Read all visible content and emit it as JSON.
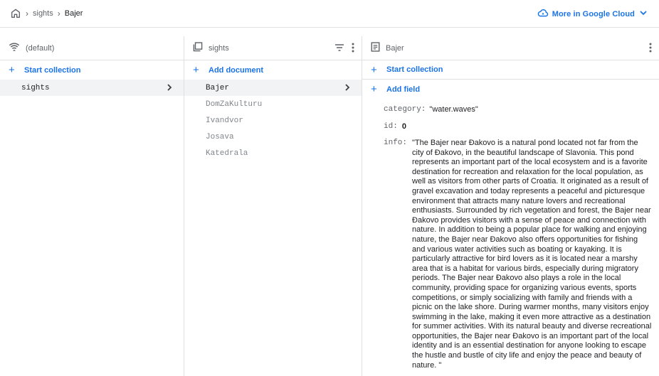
{
  "breadcrumb": {
    "items": [
      "sights",
      "Bajer"
    ]
  },
  "header": {
    "cloud_label": "More in Google Cloud"
  },
  "col1": {
    "title": "(default)",
    "action": "Start collection",
    "items": [
      {
        "label": "sights",
        "selected": true
      }
    ]
  },
  "col2": {
    "title": "sights",
    "action": "Add document",
    "items": [
      {
        "label": "Bajer",
        "selected": true
      },
      {
        "label": "DomZaKulturu"
      },
      {
        "label": "Ivandvor"
      },
      {
        "label": "Josava"
      },
      {
        "label": "Katedrala"
      }
    ]
  },
  "col3": {
    "title": "Bajer",
    "start_collection": "Start collection",
    "add_field": "Add field",
    "fields": {
      "category_key": "category:",
      "category_value": "\"water.waves\"",
      "id_key": "id:",
      "id_value": "0",
      "info_key": "info:",
      "info_value": "\"The Bajer near Đakovo is a natural pond located not far from the city of Đakovo, in the beautiful landscape of Slavonia. This pond represents an important part of the local ecosystem and is a favorite destination for recreation and relaxation for the local population, as well as visitors from other parts of Croatia. It originated as a result of gravel excavation and today represents a peaceful and picturesque environment that attracts many nature lovers and recreational enthusiasts. Surrounded by rich vegetation and forest, the Bajer near Đakovo provides visitors with a sense of peace and connection with nature. In addition to being a popular place for walking and enjoying nature, the Bajer near Đakovo also offers opportunities for fishing and various water activities such as boating or kayaking. It is particularly attractive for bird lovers as it is located near a marshy area that is a habitat for various birds, especially during migratory periods. The Bajer near Đakovo also plays a role in the local community, providing space for organizing various events, sports competitions, or simply socializing with family and friends with a picnic on the lake shore. During warmer months, many visitors enjoy swimming in the lake, making it even more attractive as a destination for summer activities. With its natural beauty and diverse recreational opportunities, the Bajer near Đakovo is an important part of the local identity and is an essential destination for anyone looking to escape the hustle and bustle of city life and enjoy the peace and beauty of nature. \""
    }
  },
  "colors": {
    "accent": "#1a73e8",
    "border": "#e0e0e0",
    "selected_bg": "#f1f3f4"
  },
  "icons": [
    "home-icon",
    "chevron-right-icon",
    "cloud-icon",
    "chevron-down-icon",
    "database-icon",
    "collection-icon",
    "filter-icon",
    "more-vert-icon",
    "document-icon",
    "plus-icon"
  ]
}
